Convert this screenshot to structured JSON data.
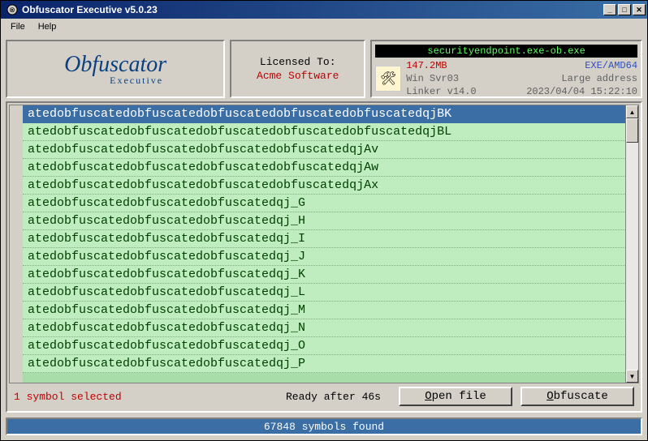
{
  "window": {
    "title": "Obfuscator Executive v5.0.23"
  },
  "menu": {
    "file": "File",
    "help": "Help"
  },
  "logo": {
    "main": "Obfuscator",
    "sub": "Executive"
  },
  "license": {
    "label": "Licensed To:",
    "name": "Acme Software"
  },
  "fileinfo": {
    "filename": "securityendpoint.exe-ob.exe",
    "size": "147.2MB",
    "os": "Win Svr03",
    "linker": "Linker v14.0",
    "arch": "EXE/AMD64",
    "address": "Large address",
    "timestamp": "2023/04/04 15:22:10"
  },
  "symbols": [
    "atedobfuscatedobfuscatedobfuscatedobfuscatedobfuscatedqjBK",
    "atedobfuscatedobfuscatedobfuscatedobfuscatedobfuscatedqjBL",
    "atedobfuscatedobfuscatedobfuscatedobfuscatedqjAv",
    "atedobfuscatedobfuscatedobfuscatedobfuscatedqjAw",
    "atedobfuscatedobfuscatedobfuscatedobfuscatedqjAx",
    "atedobfuscatedobfuscatedobfuscatedqj_G",
    "atedobfuscatedobfuscatedobfuscatedqj_H",
    "atedobfuscatedobfuscatedobfuscatedqj_I",
    "atedobfuscatedobfuscatedobfuscatedqj_J",
    "atedobfuscatedobfuscatedobfuscatedqj_K",
    "atedobfuscatedobfuscatedobfuscatedqj_L",
    "atedobfuscatedobfuscatedobfuscatedqj_M",
    "atedobfuscatedobfuscatedobfuscatedqj_N",
    "atedobfuscatedobfuscatedobfuscatedqj_O",
    "atedobfuscatedobfuscatedobfuscatedqj_P"
  ],
  "status": {
    "selection": "1 symbol selected",
    "ready": "Ready after 46s"
  },
  "buttons": {
    "open": "pen file",
    "open_key": "O",
    "obfuscate": "bfuscate",
    "obfuscate_key": "O"
  },
  "footer": {
    "count": "67848 symbols found"
  }
}
